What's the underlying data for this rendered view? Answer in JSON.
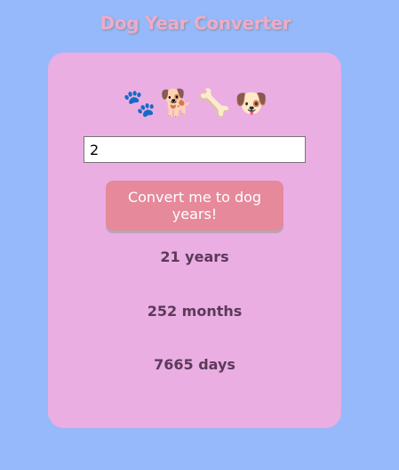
{
  "app": {
    "title": "Dog Year Converter"
  },
  "card": {
    "emojis": [
      {
        "glyph": "🐾",
        "icon": "paw-prints-icon"
      },
      {
        "glyph": "🐕",
        "icon": "dog-icon"
      },
      {
        "glyph": "🦴",
        "icon": "bone-icon"
      },
      {
        "glyph": "🐶",
        "icon": "dog-face-icon"
      }
    ],
    "input_value": "2",
    "button_label": "Convert me to dog years!",
    "results": {
      "years": "21 years",
      "months": "252 months",
      "days": "7665 days"
    }
  },
  "colors": {
    "background": "#95b9fb",
    "card": "#eaaee3",
    "button": "#e5899b",
    "title": "#ebaccb",
    "result_text": "#5b3a59"
  }
}
